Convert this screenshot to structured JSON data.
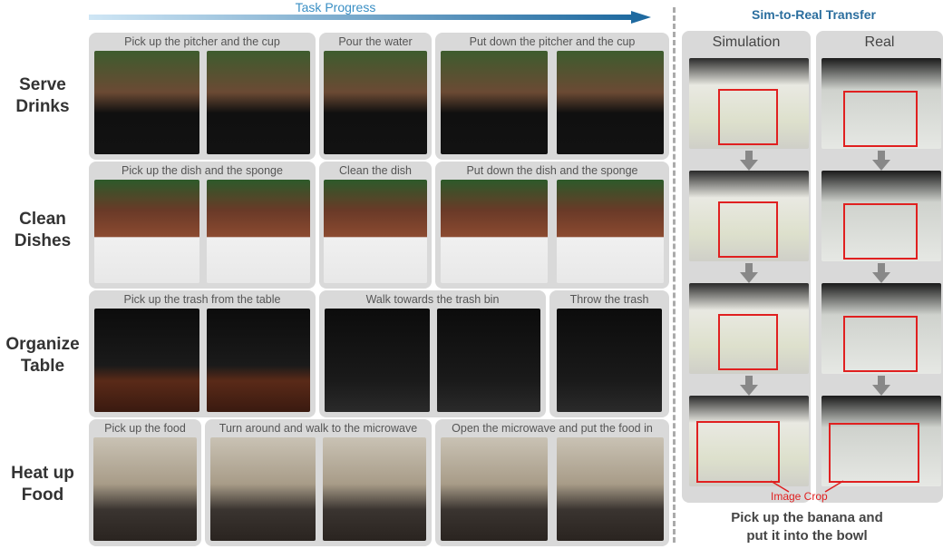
{
  "header": {
    "progress_label": "Task Progress"
  },
  "rows": [
    {
      "label_line1": "Serve",
      "label_line2": "Drinks",
      "groups": [
        "Pick up the pitcher and the cup",
        "Pour the water",
        "Put down the pitcher and the cup"
      ]
    },
    {
      "label_line1": "Clean",
      "label_line2": "Dishes",
      "groups": [
        "Pick up the dish and the sponge",
        "Clean the dish",
        "Put down the dish and the sponge"
      ]
    },
    {
      "label_line1": "Organize",
      "label_line2": "Table",
      "groups": [
        "Pick up the trash from the table",
        "Walk towards the trash bin",
        "Throw the trash"
      ]
    },
    {
      "label_line1": "Heat up",
      "label_line2": "Food",
      "groups": [
        "Pick up the food",
        "Turn around and walk to the microwave",
        "Open the microwave and put the food in"
      ]
    }
  ],
  "sim2real": {
    "title": "Sim-to-Real Transfer",
    "col_sim": "Simulation",
    "col_real": "Real",
    "crop_note": "Image Crop",
    "caption_line1": "Pick up the banana and",
    "caption_line2": "put it into the bowl"
  },
  "colors": {
    "accent_blue": "#3a8fc4",
    "crop_red": "#e02020",
    "panel_gray": "#d9d9d9"
  }
}
